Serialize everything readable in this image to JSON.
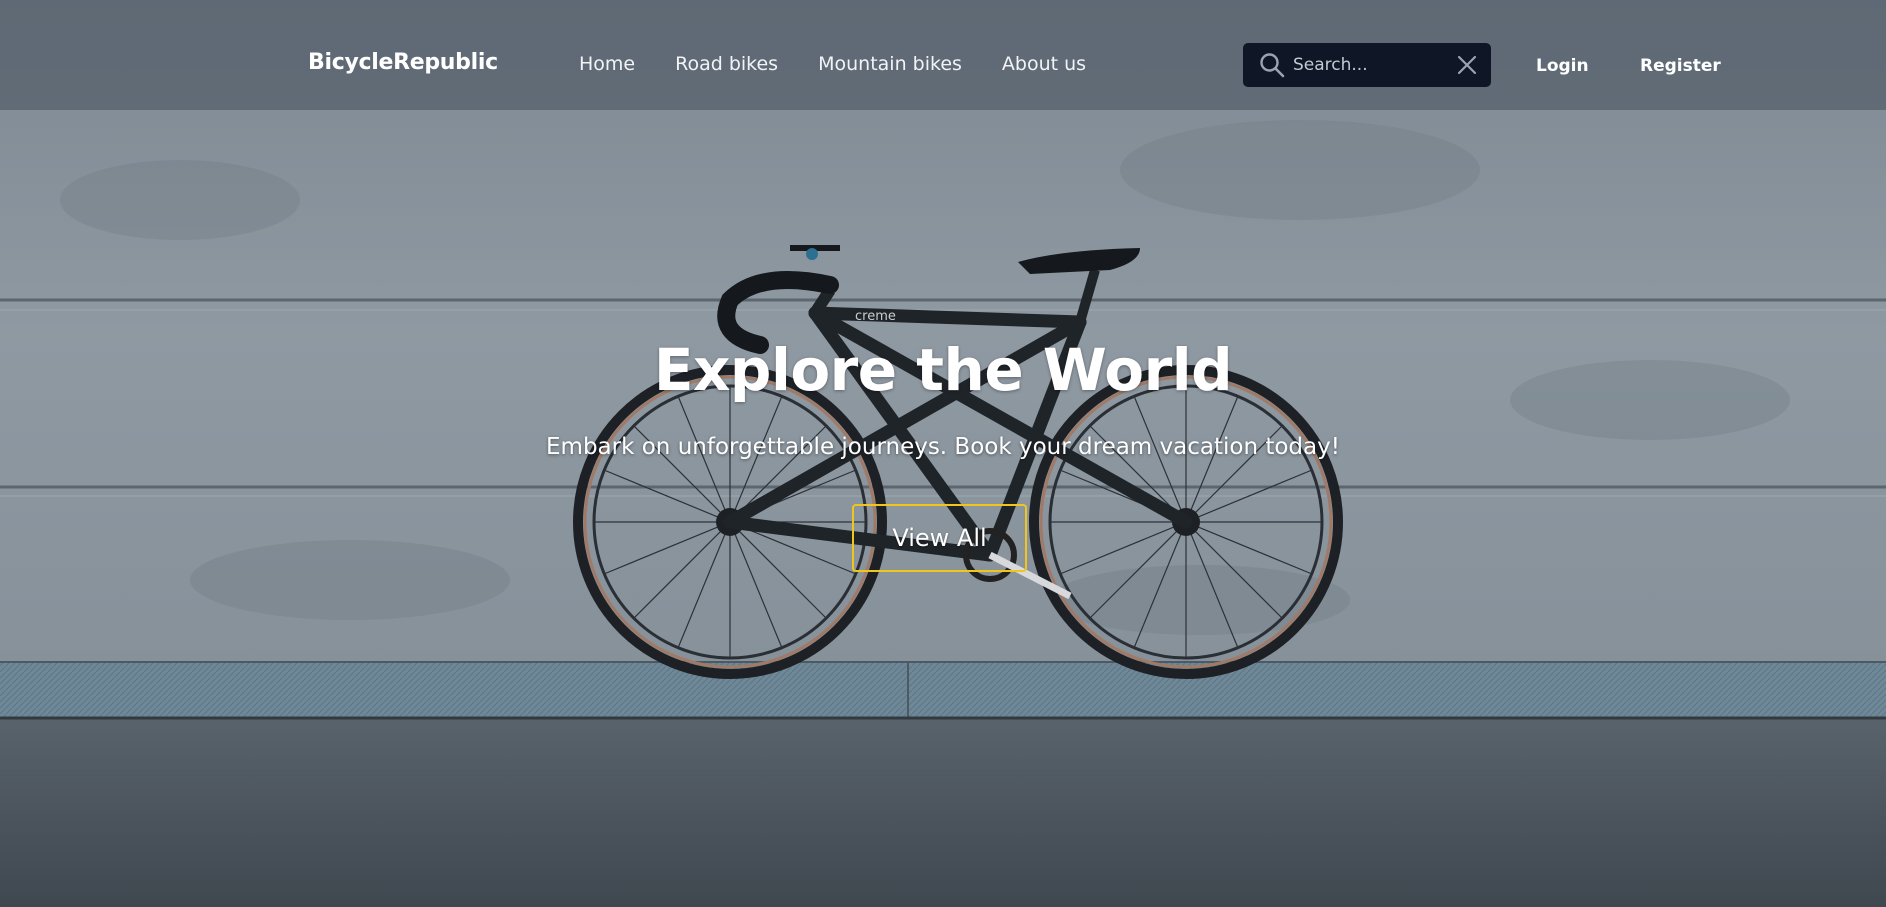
{
  "navbar": {
    "brand": "BicycleRepublic",
    "links": [
      {
        "label": "Home"
      },
      {
        "label": "Road bikes"
      },
      {
        "label": "Mountain bikes"
      },
      {
        "label": "About us"
      }
    ],
    "search": {
      "placeholder": "Search...",
      "value": ""
    },
    "login_label": "Login",
    "register_label": "Register"
  },
  "hero": {
    "title": "Explore the World",
    "subtitle": "Embark on unforgettable journeys. Book your dream vacation today!",
    "cta_label": "View All",
    "bike_brand_text": "creme"
  },
  "colors": {
    "navbar_bg": "#46505c",
    "search_bg": "#0f1726",
    "cta_border": "#f2c51d",
    "text": "#ffffff"
  },
  "icons": {
    "search": "search-icon",
    "clear": "close-icon"
  }
}
